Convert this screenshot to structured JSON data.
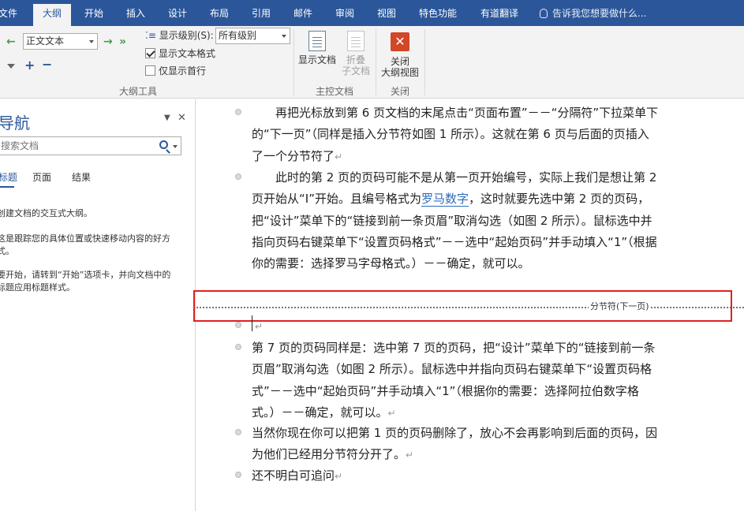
{
  "tabs": [
    {
      "label": "文件"
    },
    {
      "label": "大纲"
    },
    {
      "label": "开始"
    },
    {
      "label": "插入"
    },
    {
      "label": "设计"
    },
    {
      "label": "布局"
    },
    {
      "label": "引用"
    },
    {
      "label": "邮件"
    },
    {
      "label": "审阅"
    },
    {
      "label": "视图"
    },
    {
      "label": "特色功能"
    },
    {
      "label": "有道翻译"
    }
  ],
  "tell_me": "告诉我您想要做什么...",
  "ribbon": {
    "outline_tools": {
      "level_select": "正文文本",
      "show_level_label": "显示级别(S):",
      "show_level_value": "所有级别",
      "show_text_format": "显示文本格式",
      "show_text_format_checked": true,
      "first_line_only": "仅显示首行",
      "first_line_only_checked": false,
      "group_label": "大纲工具"
    },
    "master_document": {
      "show_document": "显示文档",
      "collapse_line1": "折叠",
      "collapse_line2": "子文档",
      "group_label": "主控文档"
    },
    "close": {
      "close_line1": "关闭",
      "close_line2": "大纲视图",
      "group_label": "关闭"
    }
  },
  "nav_pane": {
    "title": "导航",
    "search_placeholder": "搜索文档",
    "tabs": [
      "标题",
      "页面",
      "结果"
    ],
    "help_lines": [
      "创建文档的交互式大纲。",
      "这是跟踪您的具体位置或快速移动内容的好方",
      "式。",
      "要开始，请转到“开始”选项卡，并向文档中的",
      "标题应用标题样式。"
    ]
  },
  "document": {
    "para1": "　　再把光标放到第 6 页文档的末尾点击“页面布置”－－“分隔符”下拉菜单下的“下一页”（同样是插入分节符如图 1 所示）。这就在第 6 页与后面的页插入了一个分节符了",
    "para2_before_link": "　　此时的第 2 页的页码可能不是从第一页开始编号，实际上我们是想让第 2 页开始从“I”开始。且编号格式为",
    "para2_link": "罗马数字",
    "para2_after_link": "，这时就要先选中第 2 页的页码，把“设计”菜单下的“链接到前一条页眉”取消勾选（如图 2 所示）。鼠标选中并指向页码右键菜单下“设置页码格式”－－选中“起始页码”并手动填入“1”（根据你的需要：选择罗马字母格式。）－－确定，就可以。",
    "section_break_label": "分节符(下一页)",
    "para3": "第 7 页的页码同样是：选中第 7 页的页码，把“设计”菜单下的“链接到前一条页眉”取消勾选（如图 2 所示）。鼠标选中并指向页码右键菜单下“设置页码格式”－－选中“起始页码”并手动填入“1”（根据你的需要：选择阿拉伯数字格式。）－－确定，就可以。",
    "para4": "当然你现在你可以把第 1 页的页码删除了，放心不会再影响到后面的页码，因为他们已经用分节符分开了。",
    "para5": "还不明白可追问",
    "return_mark": "↵"
  },
  "colors": {
    "ribbon_blue": "#2b579a",
    "highlight_red": "#e02020",
    "link_blue": "#2b6cb8"
  }
}
